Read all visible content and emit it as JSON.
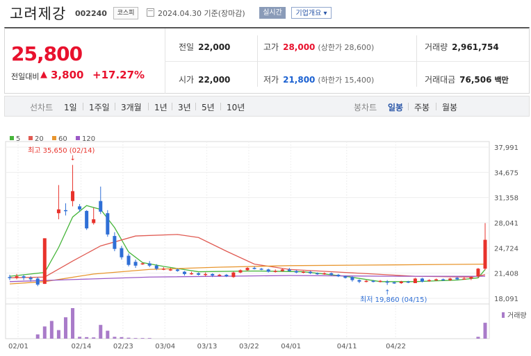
{
  "header": {
    "name": "고려제강",
    "code": "002240",
    "market": "코스피",
    "date": "2024.04.30",
    "basis": "기준(장마감)",
    "realtime_label": "실시간",
    "company_label": "기업개요 ▾"
  },
  "price": {
    "current": "25,800",
    "change_label": "전일대비",
    "change_arrow": "▲",
    "change_amount": "3,800",
    "change_rate": "+17.27%"
  },
  "stats": {
    "prev_label": "전일",
    "prev": "22,000",
    "open_label": "시가",
    "open": "22,000",
    "high_label": "고가",
    "high": "28,000",
    "upper_limit_text": "(상한가 28,600)",
    "low_label": "저가",
    "low": "21,800",
    "lower_limit_text": "(하한가 15,400)",
    "volume_label": "거래량",
    "volume": "2,961,754",
    "amount_label": "거래대금",
    "amount": "76,506",
    "amount_unit": "백만"
  },
  "tabs": {
    "line_head": "선차트",
    "line": [
      "1일",
      "1주일",
      "3개월",
      "1년",
      "3년",
      "5년",
      "10년"
    ],
    "candle_head": "봉차트",
    "candle": [
      "일봉",
      "주봉",
      "월봉"
    ],
    "active_candle": "일봉"
  },
  "chart_data": {
    "type": "candlestick",
    "legend": [
      {
        "name": "5",
        "color": "#46b53a"
      },
      {
        "name": "20",
        "color": "#e05a52"
      },
      {
        "name": "60",
        "color": "#e8962e"
      },
      {
        "name": "120",
        "color": "#9b59c6"
      }
    ],
    "y_ticks": [
      37991,
      34675,
      31358,
      28041,
      24724,
      21408,
      18091
    ],
    "y_range": [
      18091,
      37991
    ],
    "x_ticks": [
      "02/01",
      "02/14",
      "02/23",
      "03/04",
      "03/13",
      "03/22",
      "04/01",
      "04/11",
      "04/22"
    ],
    "annotations": {
      "high": {
        "text": "최고 35,650 (02/14)",
        "value": 35650
      },
      "low": {
        "text": "최저 19,860 (04/15)",
        "value": 19860
      }
    },
    "volume_label": "거래량",
    "candles": [
      {
        "d": 0,
        "o": 20900,
        "c": 20800,
        "h": 21200,
        "l": 20500
      },
      {
        "d": 1,
        "o": 20800,
        "c": 21000,
        "h": 21300,
        "l": 20600
      },
      {
        "d": 2,
        "o": 21000,
        "c": 20800,
        "h": 21200,
        "l": 20500
      },
      {
        "d": 3,
        "o": 20800,
        "c": 20600,
        "h": 21000,
        "l": 20300
      },
      {
        "d": 4,
        "o": 20700,
        "c": 19900,
        "h": 20900,
        "l": 19700
      },
      {
        "d": 5,
        "o": 20000,
        "c": 26000,
        "h": 26000,
        "l": 20000
      },
      {
        "d": 7,
        "o": 29300,
        "c": 29800,
        "h": 33000,
        "l": 28500
      },
      {
        "d": 8,
        "o": 29700,
        "c": 29600,
        "h": 30600,
        "l": 29000
      },
      {
        "d": 9,
        "o": 30900,
        "c": 32200,
        "h": 35650,
        "l": 30200
      },
      {
        "d": 10,
        "o": 30200,
        "c": 29800,
        "h": 30500,
        "l": 29500
      },
      {
        "d": 11,
        "o": 29600,
        "c": 27300,
        "h": 29700,
        "l": 27100
      },
      {
        "d": 12,
        "o": 28000,
        "c": 28500,
        "h": 30000,
        "l": 27800
      },
      {
        "d": 13,
        "o": 30900,
        "c": 29500,
        "h": 32800,
        "l": 29200
      },
      {
        "d": 14,
        "o": 29300,
        "c": 26500,
        "h": 29700,
        "l": 26200
      },
      {
        "d": 15,
        "o": 26300,
        "c": 24600,
        "h": 26800,
        "l": 24300
      },
      {
        "d": 16,
        "o": 24700,
        "c": 23500,
        "h": 25000,
        "l": 23200
      },
      {
        "d": 17,
        "o": 23700,
        "c": 22500,
        "h": 24000,
        "l": 22300
      },
      {
        "d": 18,
        "o": 22900,
        "c": 22400,
        "h": 23200,
        "l": 22100
      },
      {
        "d": 19,
        "o": 22700,
        "c": 22700,
        "h": 22800,
        "l": 22500
      },
      {
        "d": 20,
        "o": 22700,
        "c": 22400,
        "h": 23000,
        "l": 22200
      },
      {
        "d": 21,
        "o": 22400,
        "c": 22000,
        "h": 22600,
        "l": 21800
      },
      {
        "d": 22,
        "o": 22000,
        "c": 22000,
        "h": 22200,
        "l": 21800
      },
      {
        "d": 23,
        "o": 21900,
        "c": 21900,
        "h": 22100,
        "l": 21700
      },
      {
        "d": 24,
        "o": 21900,
        "c": 21700,
        "h": 22000,
        "l": 21600
      },
      {
        "d": 25,
        "o": 21600,
        "c": 21300,
        "h": 21700,
        "l": 21100
      },
      {
        "d": 26,
        "o": 21300,
        "c": 21400,
        "h": 21600,
        "l": 21200
      },
      {
        "d": 27,
        "o": 21400,
        "c": 21200,
        "h": 21500,
        "l": 21100
      },
      {
        "d": 28,
        "o": 21200,
        "c": 21300,
        "h": 21500,
        "l": 21000
      },
      {
        "d": 29,
        "o": 21300,
        "c": 21100,
        "h": 21400,
        "l": 20900
      },
      {
        "d": 30,
        "o": 21100,
        "c": 21200,
        "h": 21300,
        "l": 21000
      },
      {
        "d": 31,
        "o": 21200,
        "c": 21000,
        "h": 21300,
        "l": 20900
      },
      {
        "d": 32,
        "o": 20900,
        "c": 21500,
        "h": 21600,
        "l": 20800
      },
      {
        "d": 33,
        "o": 21500,
        "c": 21800,
        "h": 21900,
        "l": 21400
      },
      {
        "d": 34,
        "o": 21800,
        "c": 22100,
        "h": 22200,
        "l": 21700
      },
      {
        "d": 35,
        "o": 22100,
        "c": 22000,
        "h": 22300,
        "l": 21900
      },
      {
        "d": 36,
        "o": 22000,
        "c": 21900,
        "h": 22100,
        "l": 21800
      },
      {
        "d": 37,
        "o": 21900,
        "c": 21600,
        "h": 22000,
        "l": 21500
      },
      {
        "d": 38,
        "o": 21600,
        "c": 21700,
        "h": 21900,
        "l": 21500
      },
      {
        "d": 39,
        "o": 21700,
        "c": 21900,
        "h": 22000,
        "l": 21600
      },
      {
        "d": 40,
        "o": 21900,
        "c": 21700,
        "h": 22100,
        "l": 21600
      },
      {
        "d": 41,
        "o": 21700,
        "c": 21500,
        "h": 21800,
        "l": 21400
      },
      {
        "d": 42,
        "o": 21500,
        "c": 21600,
        "h": 21700,
        "l": 21400
      },
      {
        "d": 43,
        "o": 21600,
        "c": 21400,
        "h": 21700,
        "l": 21300
      },
      {
        "d": 44,
        "o": 21400,
        "c": 21300,
        "h": 21500,
        "l": 21200
      },
      {
        "d": 45,
        "o": 21300,
        "c": 21400,
        "h": 21500,
        "l": 21200
      },
      {
        "d": 46,
        "o": 21400,
        "c": 21200,
        "h": 21500,
        "l": 21100
      },
      {
        "d": 47,
        "o": 21200,
        "c": 21000,
        "h": 21300,
        "l": 20900
      },
      {
        "d": 48,
        "o": 21000,
        "c": 20800,
        "h": 21100,
        "l": 20700
      },
      {
        "d": 49,
        "o": 20900,
        "c": 20500,
        "h": 21000,
        "l": 20300
      },
      {
        "d": 50,
        "o": 20500,
        "c": 20300,
        "h": 20600,
        "l": 20100
      },
      {
        "d": 51,
        "o": 20300,
        "c": 20400,
        "h": 20500,
        "l": 20200
      },
      {
        "d": 52,
        "o": 20400,
        "c": 20300,
        "h": 20500,
        "l": 20200
      },
      {
        "d": 53,
        "o": 20300,
        "c": 20400,
        "h": 20500,
        "l": 20200
      },
      {
        "d": 54,
        "o": 20300,
        "c": 20200,
        "h": 20500,
        "l": 19860
      },
      {
        "d": 55,
        "o": 20200,
        "c": 20100,
        "h": 20300,
        "l": 20000
      },
      {
        "d": 56,
        "o": 20100,
        "c": 20300,
        "h": 20400,
        "l": 20000
      },
      {
        "d": 57,
        "o": 20300,
        "c": 20200,
        "h": 20400,
        "l": 20100
      },
      {
        "d": 58,
        "o": 20100,
        "c": 20700,
        "h": 20800,
        "l": 20100
      },
      {
        "d": 59,
        "o": 20700,
        "c": 20300,
        "h": 20800,
        "l": 20200
      },
      {
        "d": 60,
        "o": 20400,
        "c": 20500,
        "h": 20600,
        "l": 20300
      },
      {
        "d": 61,
        "o": 20500,
        "c": 20600,
        "h": 20700,
        "l": 20400
      },
      {
        "d": 62,
        "o": 20600,
        "c": 20500,
        "h": 20700,
        "l": 20400
      },
      {
        "d": 63,
        "o": 20500,
        "c": 20700,
        "h": 20800,
        "l": 20400
      },
      {
        "d": 64,
        "o": 20800,
        "c": 20600,
        "h": 20900,
        "l": 20500
      },
      {
        "d": 65,
        "o": 20700,
        "c": 20700,
        "h": 20900,
        "l": 20600
      },
      {
        "d": 66,
        "o": 20700,
        "c": 20900,
        "h": 21000,
        "l": 20500
      },
      {
        "d": 67,
        "o": 21000,
        "c": 22000,
        "h": 22100,
        "l": 20800
      },
      {
        "d": 68,
        "o": 22000,
        "c": 25800,
        "h": 28000,
        "l": 21800
      }
    ],
    "ma": {
      "5": [
        [
          0,
          21000
        ],
        [
          5,
          21500
        ],
        [
          7,
          24800
        ],
        [
          9,
          28800
        ],
        [
          11,
          30300
        ],
        [
          13,
          29800
        ],
        [
          15,
          27400
        ],
        [
          17,
          24200
        ],
        [
          19,
          22800
        ],
        [
          22,
          22300
        ],
        [
          27,
          21600
        ],
        [
          35,
          21700
        ],
        [
          42,
          21600
        ],
        [
          48,
          21000
        ],
        [
          53,
          20300
        ],
        [
          58,
          20300
        ],
        [
          64,
          20500
        ],
        [
          67,
          20800
        ],
        [
          68,
          21900
        ]
      ],
      "20": [
        [
          0,
          20800
        ],
        [
          5,
          20900
        ],
        [
          9,
          23000
        ],
        [
          13,
          25000
        ],
        [
          18,
          26300
        ],
        [
          24,
          26500
        ],
        [
          27,
          26100
        ],
        [
          31,
          24300
        ],
        [
          35,
          22600
        ],
        [
          40,
          21900
        ],
        [
          48,
          21500
        ],
        [
          58,
          21000
        ],
        [
          66,
          20900
        ],
        [
          68,
          21200
        ]
      ],
      "60": [
        [
          0,
          20000
        ],
        [
          5,
          20300
        ],
        [
          12,
          21300
        ],
        [
          20,
          21900
        ],
        [
          30,
          22200
        ],
        [
          40,
          22400
        ],
        [
          55,
          22500
        ],
        [
          68,
          22600
        ]
      ],
      "120": [
        [
          0,
          20300
        ],
        [
          10,
          20600
        ],
        [
          20,
          20900
        ],
        [
          40,
          21100
        ],
        [
          55,
          21000
        ],
        [
          68,
          21000
        ]
      ]
    },
    "volume": [
      {
        "d": 4,
        "v": 14
      },
      {
        "d": 5,
        "v": 40
      },
      {
        "d": 6,
        "v": 58
      },
      {
        "d": 7,
        "v": 28
      },
      {
        "d": 8,
        "v": 70
      },
      {
        "d": 9,
        "v": 100
      },
      {
        "d": 10,
        "v": 6
      },
      {
        "d": 11,
        "v": 5
      },
      {
        "d": 12,
        "v": 4
      },
      {
        "d": 13,
        "v": 45
      },
      {
        "d": 14,
        "v": 26
      },
      {
        "d": 15,
        "v": 6
      },
      {
        "d": 16,
        "v": 5
      },
      {
        "d": 17,
        "v": 3
      },
      {
        "d": 18,
        "v": 2
      },
      {
        "d": 19,
        "v": 2
      },
      {
        "d": 20,
        "v": 2
      },
      {
        "d": 67,
        "v": 6
      },
      {
        "d": 68,
        "v": 52
      }
    ]
  }
}
